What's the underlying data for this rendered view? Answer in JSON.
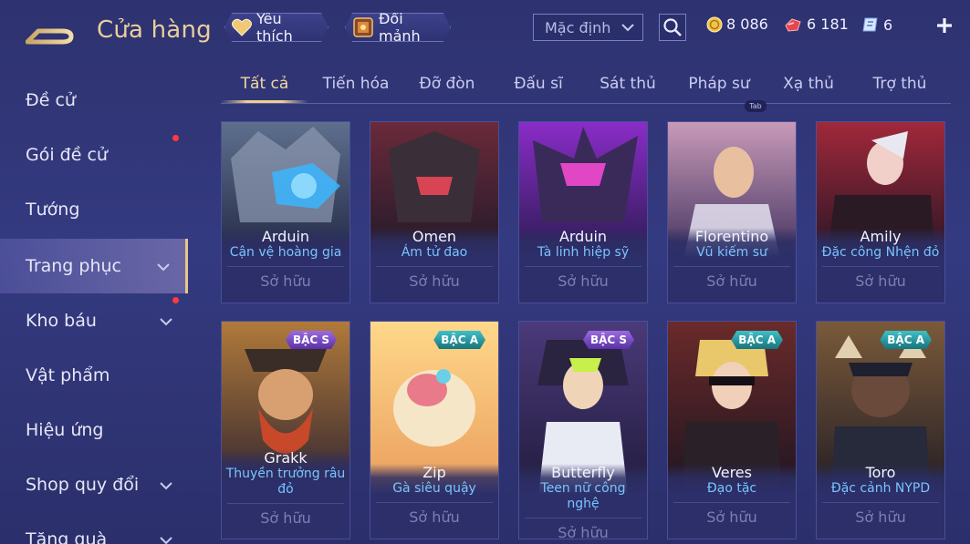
{
  "header": {
    "title": "Cửa hàng",
    "favorites_label": "Yêu thích",
    "fragments_label": "Đổi mảnh",
    "sort_value": "Mặc định",
    "currencies": {
      "gold": "8 086",
      "ruby": "6 181",
      "voucher": "6"
    }
  },
  "sidebar": {
    "items": [
      {
        "label": "Đề cử"
      },
      {
        "label": "Gói đề cử"
      },
      {
        "label": "Tướng"
      },
      {
        "label": "Trang phục"
      },
      {
        "label": "Kho báu"
      },
      {
        "label": "Vật phẩm"
      },
      {
        "label": "Hiệu ứng"
      },
      {
        "label": "Shop quy đổi"
      },
      {
        "label": "Tặng quà"
      }
    ]
  },
  "tabs": [
    {
      "label": "Tất cả"
    },
    {
      "label": "Tiến hóa"
    },
    {
      "label": "Đỡ đòn"
    },
    {
      "label": "Đấu sĩ"
    },
    {
      "label": "Sát thủ"
    },
    {
      "label": "Pháp sư"
    },
    {
      "label": "Xạ thủ"
    },
    {
      "label": "Trợ thủ"
    }
  ],
  "tab_hint": "Tab",
  "cards": [
    {
      "hero": "Arduin",
      "skin": "Cận vệ hoàng gia",
      "status": "Sở hữu",
      "tier": ""
    },
    {
      "hero": "Omen",
      "skin": "Ám tử đao",
      "status": "Sở hữu",
      "tier": ""
    },
    {
      "hero": "Arduin",
      "skin": "Tà linh hiệp sỹ",
      "status": "Sở hữu",
      "tier": ""
    },
    {
      "hero": "Florentino",
      "skin": "Vũ kiếm sư",
      "status": "Sở hữu",
      "tier": ""
    },
    {
      "hero": "Amily",
      "skin": "Đặc công Nhện đỏ",
      "status": "Sở hữu",
      "tier": ""
    },
    {
      "hero": "Grakk",
      "skin": "Thuyền trưởng râu đỏ",
      "status": "Sở hữu",
      "tier": "BẬC S"
    },
    {
      "hero": "Zip",
      "skin": "Gà siêu quậy",
      "status": "Sở hữu",
      "tier": "BẬC A"
    },
    {
      "hero": "Butterfly",
      "skin": "Teen nữ công nghệ",
      "status": "Sở hữu",
      "tier": "BẬC S"
    },
    {
      "hero": "Veres",
      "skin": "Đạo tặc",
      "status": "Sở hữu",
      "tier": "BẬC A"
    },
    {
      "hero": "Toro",
      "skin": "Đặc cảnh NYPD",
      "status": "Sở hữu",
      "tier": "BẬC A"
    }
  ],
  "colors": {
    "accent_gold": "#e9cf9a",
    "skin_name_blue": "#78c4ff",
    "badge_red": "#ff3b3b",
    "tier_s": "#7a4cc8",
    "tier_a": "#2a9aa2"
  }
}
